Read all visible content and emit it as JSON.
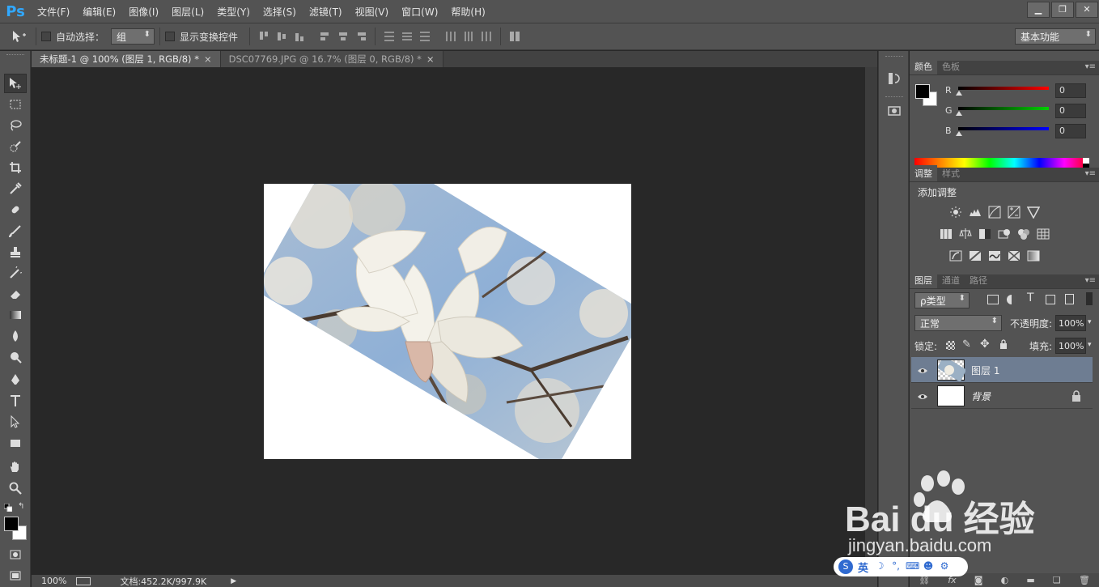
{
  "app": {
    "logo": "Ps"
  },
  "menu": [
    "文件(F)",
    "编辑(E)",
    "图像(I)",
    "图层(L)",
    "类型(Y)",
    "选择(S)",
    "滤镜(T)",
    "视图(V)",
    "窗口(W)",
    "帮助(H)"
  ],
  "window_controls": {
    "minimize": "▁",
    "restore": "❐",
    "close": "✕"
  },
  "options": {
    "auto_select_label": "自动选择：",
    "auto_select_value": "组",
    "transform_label": "显示变换控件",
    "workspace": "基本功能"
  },
  "tabs": [
    {
      "label": "未标题-1 @ 100% (图层 1, RGB/8) *",
      "close": "×"
    },
    {
      "label": "DSC07769.JPG @ 16.7% (图层 0, RGB/8) *",
      "close": "×"
    }
  ],
  "status": {
    "zoom": "100%",
    "doc": "文档:452.2K/997.9K",
    "arrow": "▶"
  },
  "color_panel": {
    "tabs": [
      "颜色",
      "色板"
    ],
    "channels": [
      {
        "label": "R",
        "value": "0",
        "color": "#ff0000"
      },
      {
        "label": "G",
        "value": "0",
        "color": "#00c000"
      },
      {
        "label": "B",
        "value": "0",
        "color": "#0000ff"
      }
    ]
  },
  "adjust_panel": {
    "tabs": [
      "调整",
      "样式"
    ],
    "title": "添加调整"
  },
  "layers_panel": {
    "tabs": [
      "图层",
      "通道",
      "路径"
    ],
    "filter": "ρ类型",
    "blend_mode": "正常",
    "opacity_label": "不透明度:",
    "opacity_value": "100%",
    "lock_label": "锁定:",
    "fill_label": "填充:",
    "fill_value": "100%",
    "layers": [
      {
        "name": "图层 1",
        "selected": true
      },
      {
        "name": "背景",
        "selected": false,
        "locked": true
      }
    ]
  },
  "watermark": {
    "brand": "Bai du 经验",
    "url": "jingyan.baidu.com"
  },
  "ime": {
    "logo": "S",
    "lang": "英"
  }
}
